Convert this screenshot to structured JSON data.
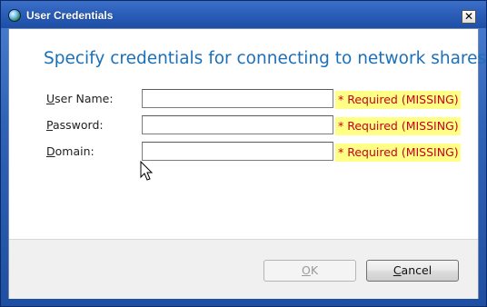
{
  "window": {
    "title": "User Credentials",
    "close_label": "✕"
  },
  "dialog": {
    "heading": "Specify credentials for connecting to network shares.",
    "fields": [
      {
        "label_accel": "U",
        "label_rest": "ser Name:",
        "value": "",
        "required_text": "* Required (MISSING)"
      },
      {
        "label_accel": "P",
        "label_rest": "assword:",
        "value": "",
        "required_text": "* Required (MISSING)"
      },
      {
        "label_accel": "D",
        "label_rest": "omain:",
        "value": "",
        "required_text": "* Required (MISSING)"
      }
    ]
  },
  "buttons": {
    "ok_accel": "O",
    "ok_rest": "K",
    "cancel_accel": "C",
    "cancel_rest": "ancel"
  },
  "colors": {
    "heading": "#1c70b8",
    "required_text": "#c8001e",
    "required_bg": "#fffe85"
  }
}
